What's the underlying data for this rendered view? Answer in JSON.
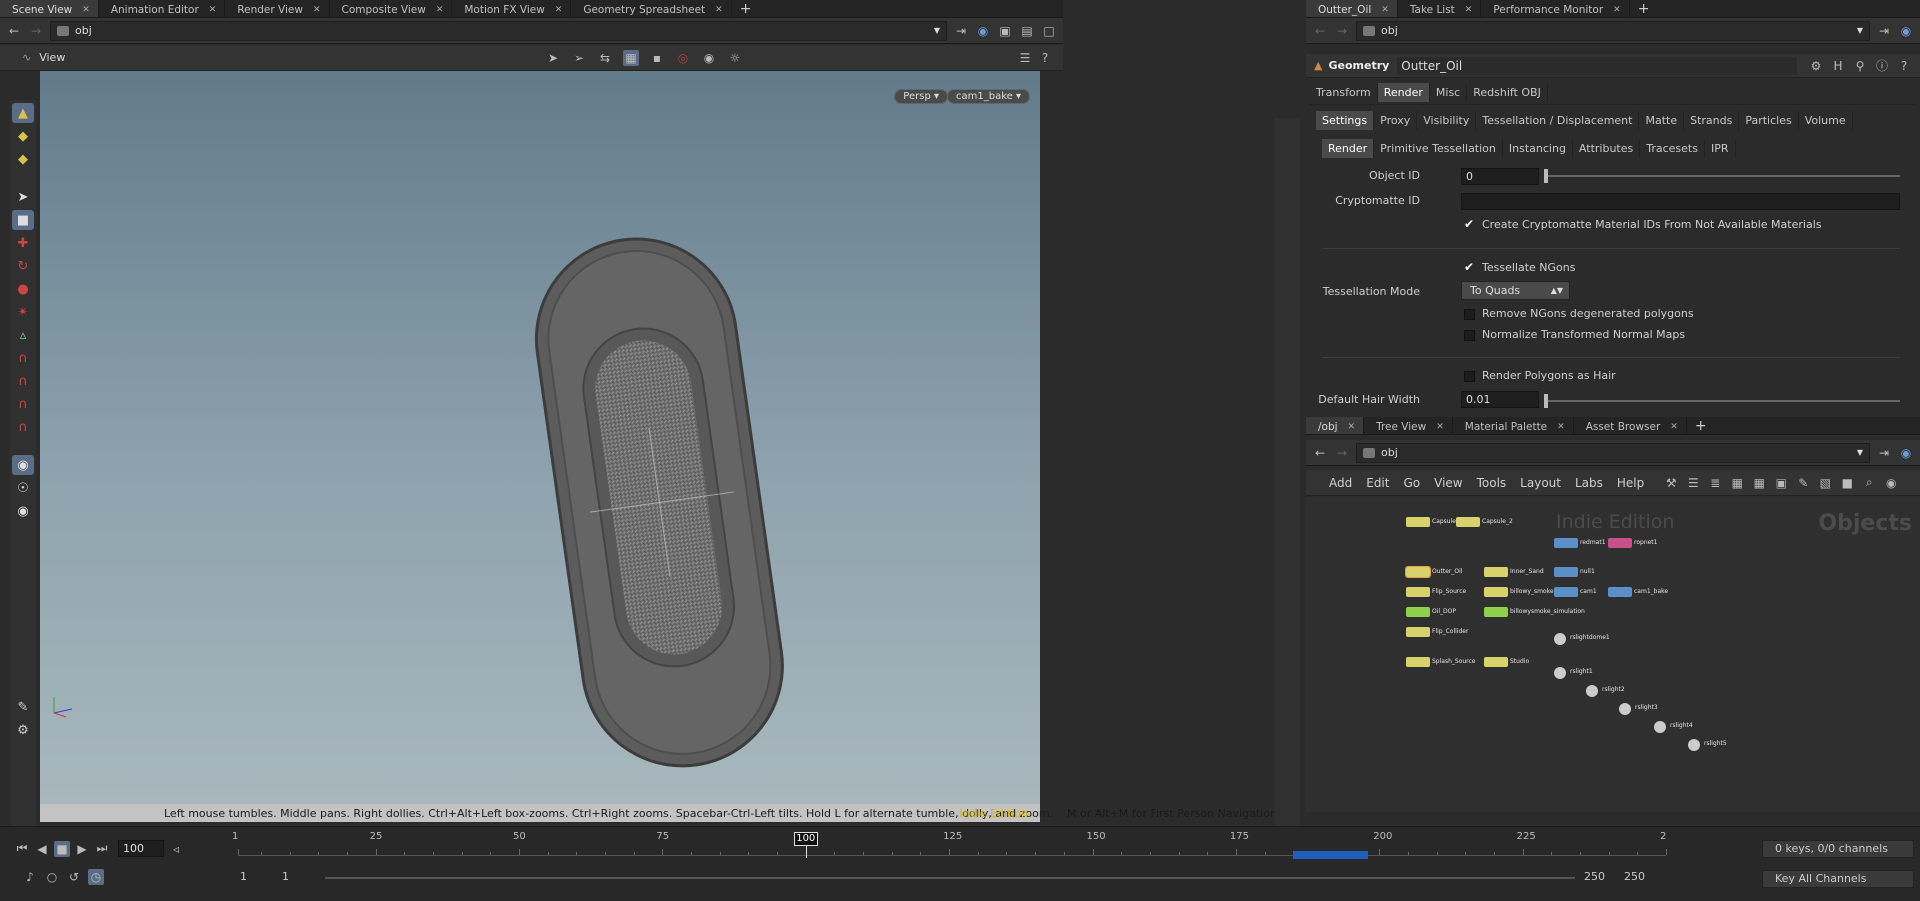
{
  "left_tabs": [
    {
      "label": "Scene View",
      "active": true
    },
    {
      "label": "Animation Editor"
    },
    {
      "label": "Render View"
    },
    {
      "label": "Composite View"
    },
    {
      "label": "Motion FX View"
    },
    {
      "label": "Geometry Spreadsheet"
    }
  ],
  "right_tabs": [
    {
      "label": "Outter_Oil",
      "active": true
    },
    {
      "label": "Take List"
    },
    {
      "label": "Performance Monitor"
    }
  ],
  "left_path": "obj",
  "right_path": "obj",
  "viewport": {
    "title": "View",
    "persp_label": "Persp",
    "camera_label": "cam1_bake",
    "status_text": "Left mouse tumbles. Middle pans. Right dollies. Ctrl+Alt+Left box-zooms. Ctrl+Right zooms. Spacebar-Ctrl-Left tilts. Hold L for alternate tumble, dolly, and zoom.    M or Alt+M for First Person Navigation.",
    "edition_label": "Indie Edition"
  },
  "params": {
    "node_type": "Geometry",
    "node_name": "Outter_Oil",
    "top_tabs": [
      "Transform",
      "Render",
      "Misc",
      "Redshift OBJ"
    ],
    "active_top_tab": "Render",
    "second_tabs": [
      "Settings",
      "Proxy",
      "Visibility",
      "Tessellation / Displacement",
      "Matte",
      "Strands",
      "Particles",
      "Volume"
    ],
    "third_tabs": [
      "Render",
      "Primitive Tessellation",
      "Instancing",
      "Attributes",
      "Tracesets",
      "IPR"
    ],
    "object_id_label": "Object ID",
    "object_id_value": "0",
    "object_id_fraction": 0.0,
    "cryptomatte_label": "Cryptomatte ID",
    "cryptomatte_value": "",
    "create_crypto_label": "Create Cryptomatte Material IDs From Not Available Materials",
    "tessellate_ngons_label": "Tessellate NGons",
    "tessellation_mode_label": "Tessellation Mode",
    "tessellation_mode_value": "To Quads",
    "remove_ngons_label": "Remove NGons degenerated polygons",
    "normalize_label": "Normalize Transformed Normal Maps",
    "render_hair_label": "Render Polygons as Hair",
    "hair_width_label": "Default Hair Width",
    "hair_width_value": "0.01",
    "hair_width_fraction": 0.0
  },
  "network": {
    "tabs": [
      {
        "label": "/obj",
        "active": true
      },
      {
        "label": "Tree View"
      },
      {
        "label": "Material Palette"
      },
      {
        "label": "Asset Browser"
      }
    ],
    "path": "obj",
    "menu": [
      "Add",
      "Edit",
      "Go",
      "View",
      "Tools",
      "Layout",
      "Labs",
      "Help"
    ],
    "watermark_edition": "Indie Edition",
    "watermark_context": "Objects",
    "nodes": [
      {
        "label": "Capsule_1",
        "color": "#d8d26a"
      },
      {
        "label": "Capsule_2",
        "color": "#d8d26a"
      },
      {
        "label": "redmat1",
        "color": "#5b8fc8"
      },
      {
        "label": "ropnet1",
        "color": "#c8508a"
      },
      {
        "label": "Outter_Oil",
        "color": "#d8d26a"
      },
      {
        "label": "Inner_Sand",
        "color": "#d8d26a"
      },
      {
        "label": "null1",
        "color": "#5b8fc8"
      },
      {
        "label": "Flip_Source",
        "color": "#d8d26a"
      },
      {
        "label": "billowy_smoke",
        "color": "#d8d26a"
      },
      {
        "label": "cam1",
        "color": "#5b8fc8"
      },
      {
        "label": "cam1_bake",
        "color": "#5b8fc8"
      },
      {
        "label": "Oil_DOP",
        "color": "#8fd04a"
      },
      {
        "label": "billowysmoke_simulation",
        "color": "#8fd04a"
      },
      {
        "label": "Flip_Collider",
        "color": "#d8d26a"
      },
      {
        "label": "rslightdome1",
        "color": "#cccccc"
      },
      {
        "label": "Splash_Source",
        "color": "#d8d26a"
      },
      {
        "label": "Studio",
        "color": "#d8d26a"
      },
      {
        "label": "rslight1",
        "color": "#cccccc"
      },
      {
        "label": "rslight2",
        "color": "#cccccc"
      },
      {
        "label": "rslight3",
        "color": "#cccccc"
      },
      {
        "label": "rslight4",
        "color": "#cccccc"
      },
      {
        "label": "rslight5",
        "color": "#cccccc"
      }
    ]
  },
  "timeline": {
    "current_frame": "100",
    "current_frame_marker": "100",
    "start_frame": "1",
    "start_frame2": "1",
    "end_frame": "250",
    "end_frame2": "250",
    "range_start": 1,
    "range_end": 250,
    "ticks": [
      "1",
      "25",
      "50",
      "75",
      "100",
      "125",
      "150",
      "175",
      "200",
      "225",
      "2"
    ],
    "keys_label": "0 keys, 0/0 channels",
    "key_all_label": "Key All Channels"
  }
}
